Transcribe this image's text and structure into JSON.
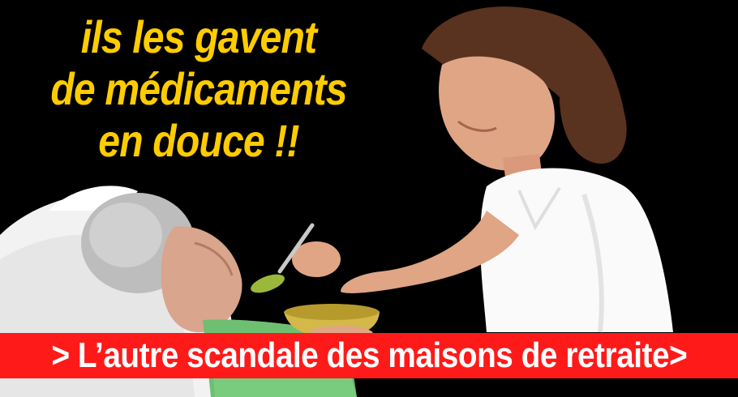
{
  "headline": {
    "line1": "ils les gavent",
    "line2": "de médicaments",
    "line3": "en douce !!"
  },
  "cta": {
    "label": "> L’autre scandale des maisons de retraite>"
  },
  "colors": {
    "background": "#000000",
    "headline": "#ffcc00",
    "cta_background": "#ff1a1a",
    "cta_text": "#ffffff"
  }
}
